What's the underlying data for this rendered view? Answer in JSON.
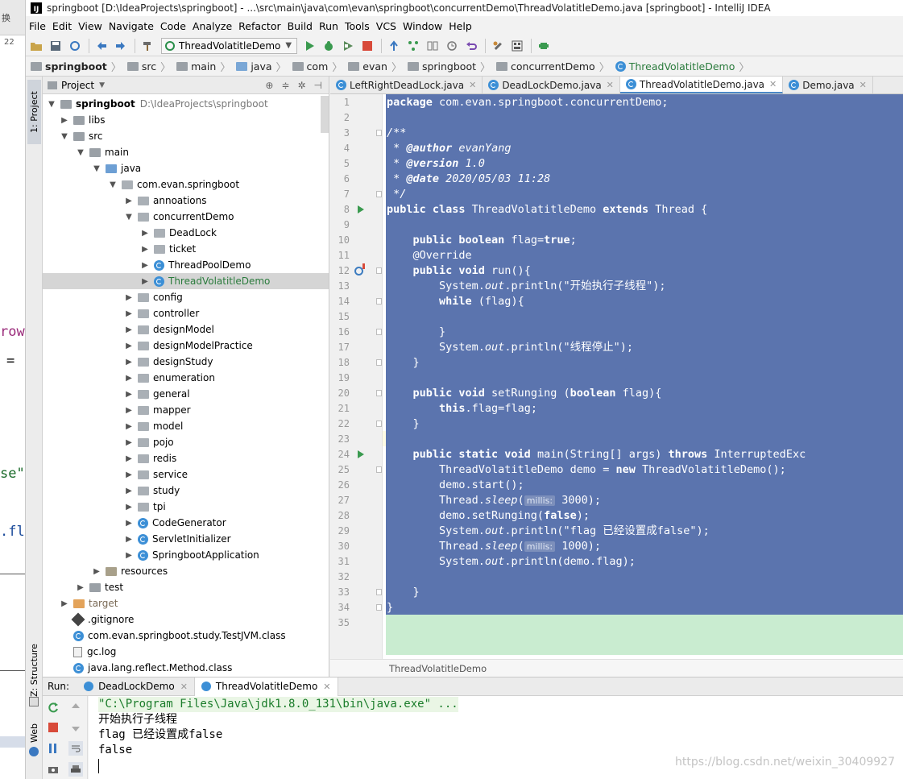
{
  "window": {
    "title": "springboot [D:\\IdeaProjects\\springboot] - ...\\src\\main\\java\\com\\evan\\springboot\\concurrentDemo\\ThreadVolatitleDemo.java [springboot] - IntelliJ IDEA",
    "logo": "IJ"
  },
  "left_sliver": {
    "top_text": "换",
    "number": "22",
    "fragments": [
      "row",
      "=",
      "se\"",
      ".fl"
    ]
  },
  "menu": [
    "File",
    "Edit",
    "View",
    "Navigate",
    "Code",
    "Analyze",
    "Refactor",
    "Build",
    "Run",
    "Tools",
    "VCS",
    "Window",
    "Help"
  ],
  "toolbar": {
    "run_config": "ThreadVolatitleDemo"
  },
  "breadcrumb": [
    "springboot",
    "src",
    "main",
    "java",
    "com",
    "evan",
    "springboot",
    "concurrentDemo",
    "ThreadVolatitleDemo"
  ],
  "left_stripe": {
    "project_tab": "1: Project",
    "structure_tab": "Z: Structure",
    "web_tab": "Web"
  },
  "project_panel": {
    "title": "Project",
    "root_name": "springboot",
    "root_path": "D:\\IdeaProjects\\springboot",
    "tree": [
      {
        "label": "libs"
      },
      {
        "label": "src"
      },
      {
        "label": "main"
      },
      {
        "label": "java"
      },
      {
        "label": "com.evan.springboot"
      },
      {
        "label": "annoations"
      },
      {
        "label": "concurrentDemo"
      },
      {
        "label": "DeadLock"
      },
      {
        "label": "ticket"
      },
      {
        "label": "ThreadPoolDemo"
      },
      {
        "label": "ThreadVolatitleDemo"
      },
      {
        "label": "config"
      },
      {
        "label": "controller"
      },
      {
        "label": "designModel"
      },
      {
        "label": "designModelPractice"
      },
      {
        "label": "designStudy"
      },
      {
        "label": "enumeration"
      },
      {
        "label": "general"
      },
      {
        "label": "mapper"
      },
      {
        "label": "model"
      },
      {
        "label": "pojo"
      },
      {
        "label": "redis"
      },
      {
        "label": "service"
      },
      {
        "label": "study"
      },
      {
        "label": "tpi"
      },
      {
        "label": "CodeGenerator"
      },
      {
        "label": "ServletInitializer"
      },
      {
        "label": "SpringbootApplication"
      },
      {
        "label": "resources"
      },
      {
        "label": "test"
      },
      {
        "label": "target"
      },
      {
        "label": ".gitignore"
      },
      {
        "label": "com.evan.springboot.study.TestJVM.class"
      },
      {
        "label": "gc.log"
      },
      {
        "label": "java.lang.reflect.Method.class"
      }
    ]
  },
  "editor_tabs": [
    "LeftRightDeadLock.java",
    "DeadLockDemo.java",
    "ThreadVolatitleDemo.java",
    "Demo.java"
  ],
  "line_numbers": [
    "1",
    "2",
    "3",
    "4",
    "5",
    "6",
    "7",
    "8",
    "9",
    "10",
    "11",
    "12",
    "13",
    "14",
    "15",
    "16",
    "17",
    "18",
    "19",
    "20",
    "21",
    "22",
    "23",
    "24",
    "25",
    "26",
    "27",
    "28",
    "29",
    "30",
    "31",
    "32",
    "33",
    "34",
    "35"
  ],
  "code": {
    "l1a": "package",
    "l1b": " com.evan.springboot.concurrentDemo;",
    "l3": "/**",
    "l4a": " * ",
    "l4b": "@author",
    "l4c": " evanYang",
    "l5a": " * ",
    "l5b": "@version",
    "l5c": " 1.0",
    "l6a": " * ",
    "l6b": "@date",
    "l6c": " 2020/05/03 11:28",
    "l7": " */",
    "l8a": "public class",
    "l8b": " ThreadVolatitleDemo ",
    "l8c": "extends",
    "l8d": " Thread {",
    "l10a": "    public boolean",
    "l10b": " flag=",
    "l10c": "true",
    "l10d": ";",
    "l11": "    @Override",
    "l12a": "    public void",
    "l12b": " run(){",
    "l13a": "        System.",
    "l13b": "out",
    "l13c": ".println(\"开始执行子线程\");",
    "l14a": "        while",
    "l14b": " (flag){",
    "l16": "        }",
    "l17a": "        System.",
    "l17b": "out",
    "l17c": ".println(\"线程停止\");",
    "l18": "    }",
    "l20a": "    public void",
    "l20b": " setRunging (",
    "l20c": "boolean",
    "l20d": " flag){",
    "l21a": "        this",
    "l21b": ".flag=flag;",
    "l22": "    }",
    "l24a": "    public static void",
    "l24b": " main(String[] args) ",
    "l24c": "throws",
    "l24d": " InterruptedExc",
    "l25a": "        ThreadVolatitleDemo demo = ",
    "l25b": "new",
    "l25c": " ThreadVolatitleDemo();",
    "l26": "        demo.start();",
    "l27a": "        Thread.",
    "l27b": "sleep",
    "l27c": "(",
    "l27hint": "millis:",
    "l27d": " 3000);",
    "l28a": "        demo.setRunging(",
    "l28b": "false",
    "l28c": ");",
    "l29a": "        System.",
    "l29b": "out",
    "l29c": ".println(\"flag 已经设置成false\");",
    "l30a": "        Thread.",
    "l30b": "sleep",
    "l30c": "(",
    "l30hint": "millis:",
    "l30d": " 1000);",
    "l31a": "        System.",
    "l31b": "out",
    "l31c": ".println(demo.flag);",
    "l33": "    }",
    "l34": "}"
  },
  "editor_breadcrumb": "ThreadVolatitleDemo",
  "run_panel": {
    "label": "Run:",
    "tabs": [
      "DeadLockDemo",
      "ThreadVolatitleDemo"
    ],
    "console": [
      "\"C:\\Program Files\\Java\\jdk1.8.0_131\\bin\\java.exe\" ...",
      "开始执行子线程",
      "flag 已经设置成false",
      "false"
    ]
  },
  "watermark": "https://blog.csdn.net/weixin_30409927",
  "colors": {
    "selection": "#5b74ae",
    "run_green": "#3a9a4f",
    "class_blue": "#3c8fd6",
    "console_cmd": "#1a7c2a"
  }
}
